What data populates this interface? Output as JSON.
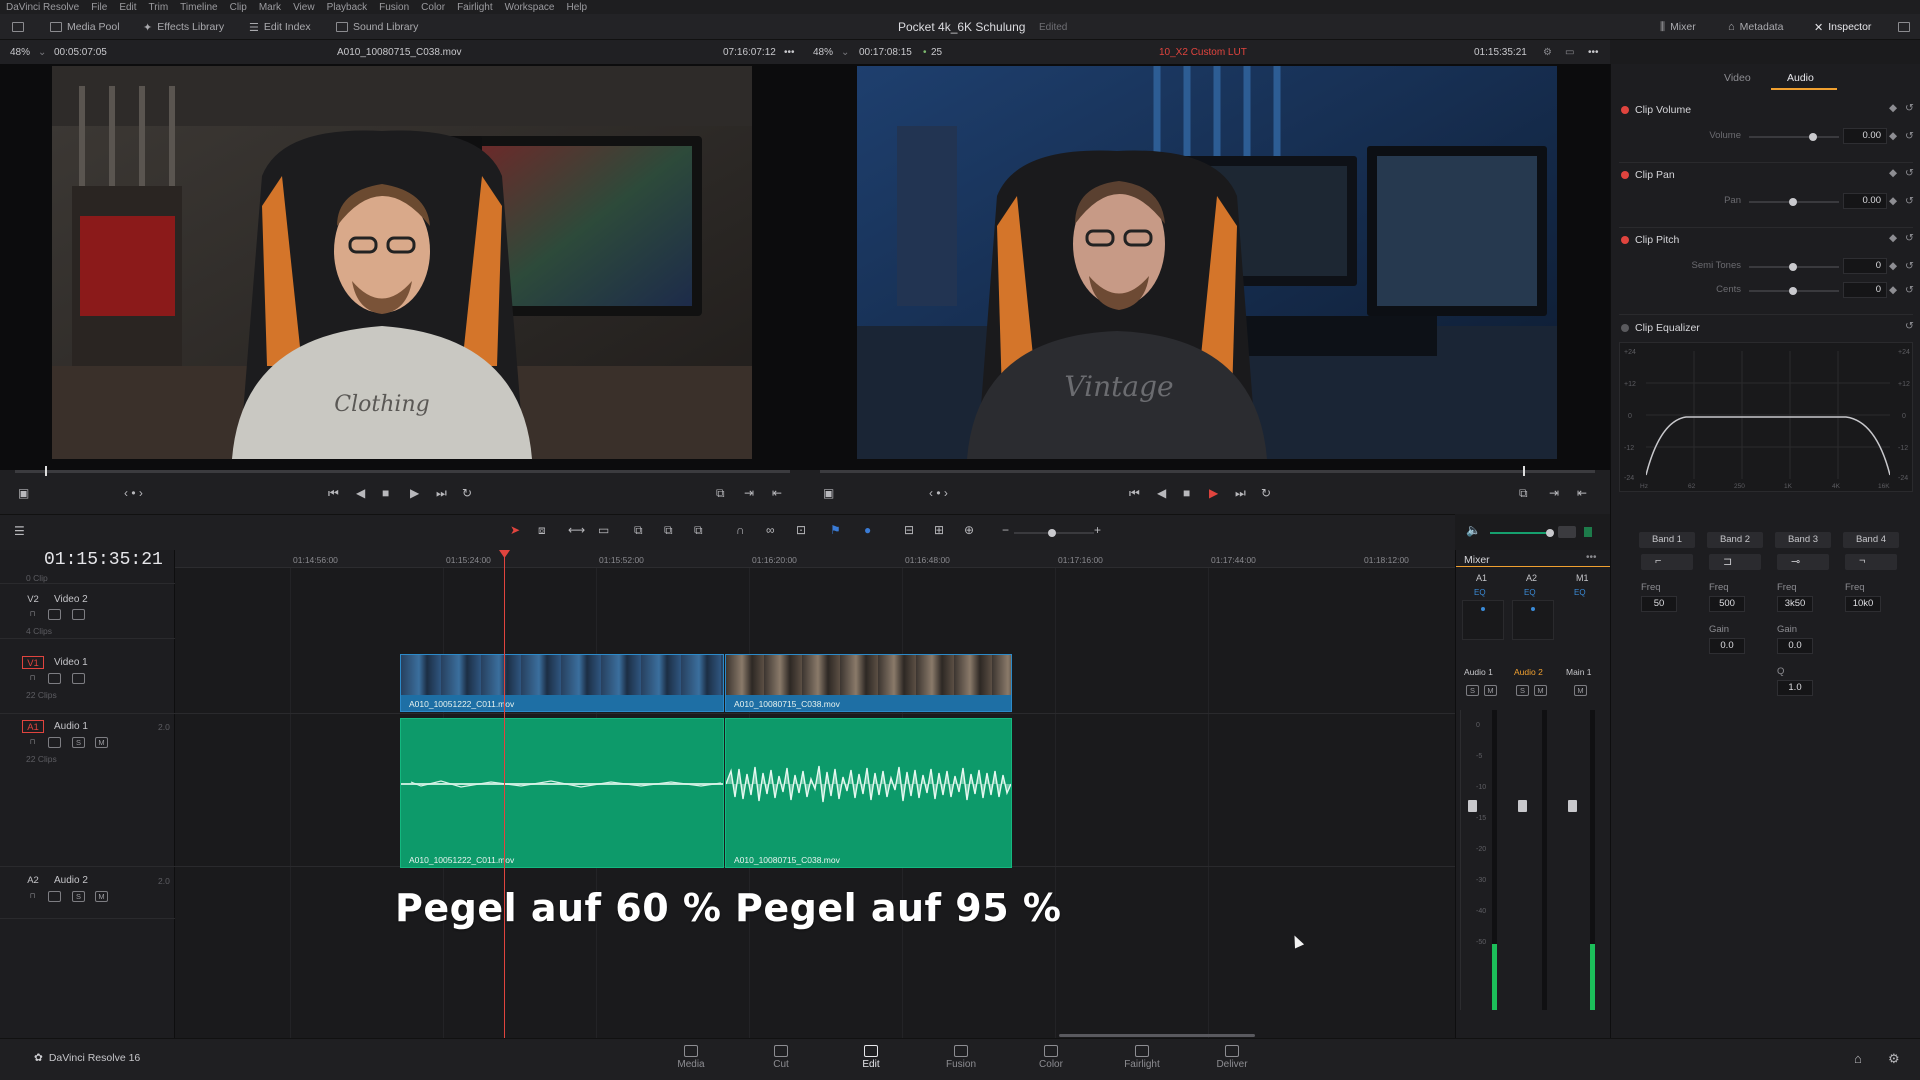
{
  "menu": {
    "items": [
      "DaVinci Resolve",
      "File",
      "Edit",
      "Trim",
      "Timeline",
      "Clip",
      "Mark",
      "View",
      "Playback",
      "Fusion",
      "Color",
      "Fairlight",
      "Workspace",
      "Help"
    ]
  },
  "toolbar": {
    "media_pool": "Media Pool",
    "effects_library": "Effects Library",
    "edit_index": "Edit Index",
    "sound_library": "Sound Library",
    "project_title": "Pocket 4k_6K Schulung",
    "project_status": "Edited",
    "mixer": "Mixer",
    "metadata": "Metadata",
    "inspector": "Inspector"
  },
  "source_viewer": {
    "zoom": "48%",
    "timecode_duration": "00:05:07:05",
    "clip_name": "A010_10080715_C038.mov",
    "timecode": "07:16:07:12"
  },
  "timeline_viewer": {
    "zoom": "48%",
    "duration": "00:17:08:15",
    "fps": "25",
    "lut": "10_X2 Custom LUT",
    "timecode": "01:15:35:21"
  },
  "timeline": {
    "current_timecode": "01:15:35:21",
    "ruler": [
      "01:14:56:00",
      "01:15:24:00",
      "01:15:52:00",
      "01:16:20:00",
      "01:16:48:00",
      "01:17:16:00",
      "01:17:44:00",
      "01:18:12:00"
    ],
    "tracks": {
      "v2": {
        "id": "V2",
        "name": "Video 2",
        "clips": "4 Clips"
      },
      "v1": {
        "id": "V1",
        "name": "Video 1",
        "clips": "22 Clips"
      },
      "a1": {
        "id": "A1",
        "name": "Audio 1",
        "clips": "22 Clips",
        "level": "2.0"
      },
      "a2": {
        "id": "A2",
        "name": "Audio 2",
        "level": "2.0"
      }
    },
    "top_clips_label": "0 Clip",
    "clips": {
      "video_1_name": "A010_10051222_C011.mov",
      "video_2_name": "A010_10080715_C038.mov",
      "audio_1_name": "A010_10051222_C011.mov",
      "audio_2_name": "A010_10080715_C038.mov"
    },
    "overlay_left": "Pegel auf 60 %",
    "overlay_right": "Pegel auf 95 %"
  },
  "mixer": {
    "title": "Mixer",
    "channels": [
      "A1",
      "A2",
      "M1"
    ],
    "strip_names": [
      "Audio 1",
      "Audio 2",
      "Main 1"
    ],
    "eq_label": "EQ",
    "scale": [
      "0",
      "-5",
      "-10",
      "-15",
      "-20",
      "-30",
      "-40",
      "-50"
    ],
    "levels": {
      "a1": 0.22,
      "a2": 0.0,
      "main": 0.22
    }
  },
  "inspector": {
    "tab_video": "Video",
    "tab_audio": "Audio",
    "clip_volume": "Clip Volume",
    "volume_label": "Volume",
    "volume_value": "0.00",
    "clip_pan": "Clip Pan",
    "pan_label": "Pan",
    "pan_value": "0.00",
    "clip_pitch": "Clip Pitch",
    "semitones_label": "Semi Tones",
    "semitones_value": "0",
    "cents_label": "Cents",
    "cents_value": "0",
    "clip_equalizer": "Clip Equalizer",
    "eq_y_ticks": [
      "+24",
      "+12",
      "0",
      "-12",
      "-24"
    ],
    "eq_x_ticks": [
      "Hz",
      "62",
      "250",
      "1K",
      "4K",
      "16K"
    ],
    "bands": [
      {
        "label": "Band 1",
        "freq_label": "Freq",
        "freq": "50"
      },
      {
        "label": "Band 2",
        "freq_label": "Freq",
        "freq": "500",
        "gain_label": "Gain",
        "gain": "0.0"
      },
      {
        "label": "Band 3",
        "freq_label": "Freq",
        "freq": "3k50",
        "gain_label": "Gain",
        "gain": "0.0",
        "q_label": "Q",
        "q": "1.0"
      },
      {
        "label": "Band 4",
        "freq_label": "Freq",
        "freq": "10k0"
      }
    ]
  },
  "bottom": {
    "app_name": "DaVinci Resolve 16",
    "pages": [
      "Media",
      "Cut",
      "Edit",
      "Fusion",
      "Color",
      "Fairlight",
      "Deliver"
    ],
    "active_page": "Edit"
  },
  "colors": {
    "accent_red": "#e0443e",
    "accent_orange": "#f0a030",
    "video_clip": "#1e6fa5",
    "audio_clip": "#0d9a6a"
  }
}
